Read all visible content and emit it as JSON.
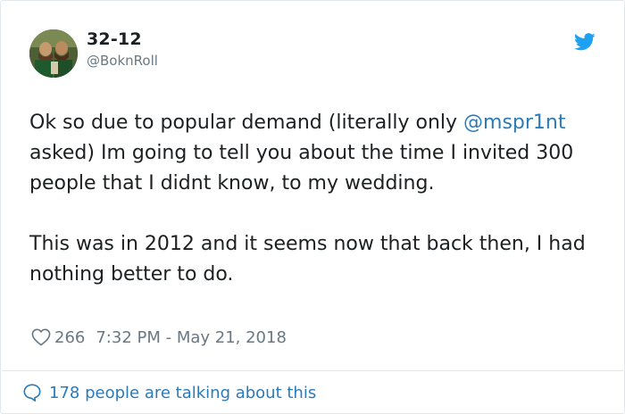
{
  "author": {
    "display_name": "32-12",
    "handle": "@BoknRoll",
    "avatar_icon": "user-avatar"
  },
  "brand": {
    "icon": "twitter-bird-icon",
    "color": "#1da1f2"
  },
  "tweet": {
    "paragraph1_before": "Ok so due to popular demand (literally only ",
    "mention": "@mspr1nt",
    "paragraph1_after": " asked) Im going to tell you about the time I invited 300 people that I didnt know, to my wedding.",
    "paragraph2": "This was in 2012 and it seems now that back then, I had nothing better to do."
  },
  "meta": {
    "like_icon": "heart-icon",
    "likes": "266",
    "timestamp": "7:32 PM - May 21, 2018"
  },
  "footer": {
    "icon": "speech-bubble-icon",
    "talking_text": "178 people are talking about this"
  },
  "colors": {
    "link": "#2b7bb9",
    "muted": "#697882",
    "text": "#1c2022",
    "border": "#e1e8ed"
  }
}
